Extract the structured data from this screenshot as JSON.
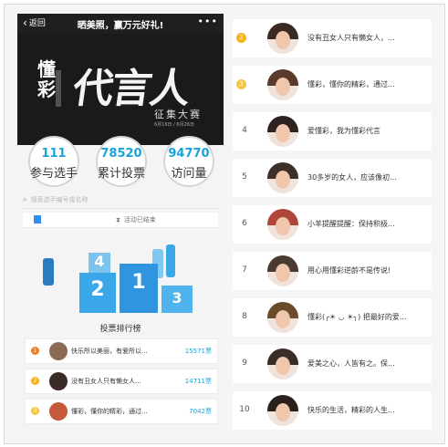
{
  "header": {
    "back_label": "返回",
    "title": "晒美照，赢万元好礼!",
    "more": "•••"
  },
  "banner": {
    "brand": "懂彩",
    "headline": "代言人",
    "subtitle": "征集大赛",
    "dates": "6月16日 / 6月26日"
  },
  "stats": [
    {
      "value": "111",
      "label": "参与选手"
    },
    {
      "value": "78520",
      "label": "累计投票"
    },
    {
      "value": "94770",
      "label": "访问量"
    }
  ],
  "search": {
    "placeholder": "搜索选手编号或名称"
  },
  "tabs": {
    "status": "活动已结束"
  },
  "podium": {
    "first": "1",
    "second": "2",
    "third": "3",
    "fourth": "4"
  },
  "ranking_title": "投票排行榜",
  "left_list": [
    {
      "rank": "1",
      "text": "快乐所以美丽，有爱所以...",
      "votes": "15571票"
    },
    {
      "rank": "2",
      "text": "没有丑女人只有懒女人...",
      "votes": "14711票"
    },
    {
      "rank": "3",
      "text": "懂彩，懂你的精彩，通过...",
      "votes": "7042票"
    }
  ],
  "right_list": [
    {
      "rank": "2",
      "text": "没有丑女人只有懒女人，..."
    },
    {
      "rank": "3",
      "text": "懂彩，懂你的精彩，通过..."
    },
    {
      "rank": "4",
      "text": "爱懂彩，我为懂彩代言"
    },
    {
      "rank": "5",
      "text": "30多岁的女人，应该像初..."
    },
    {
      "rank": "6",
      "text": "小羊提醒提醒：保持积极..."
    },
    {
      "rank": "7",
      "text": "用心用懂彩逆龄不是传说!"
    },
    {
      "rank": "8",
      "text": "懂彩(╭☀ ◡ ☀╮) 把最好的爱..."
    },
    {
      "rank": "9",
      "text": "爱美之心，人皆有之。保..."
    },
    {
      "rank": "10",
      "text": "快乐的生活，精彩的人生..."
    }
  ],
  "colors": {
    "accent": "#19a3d9",
    "gold": "#f5b21b",
    "orange": "#f27b1e",
    "podium": "#3aa7e8"
  }
}
